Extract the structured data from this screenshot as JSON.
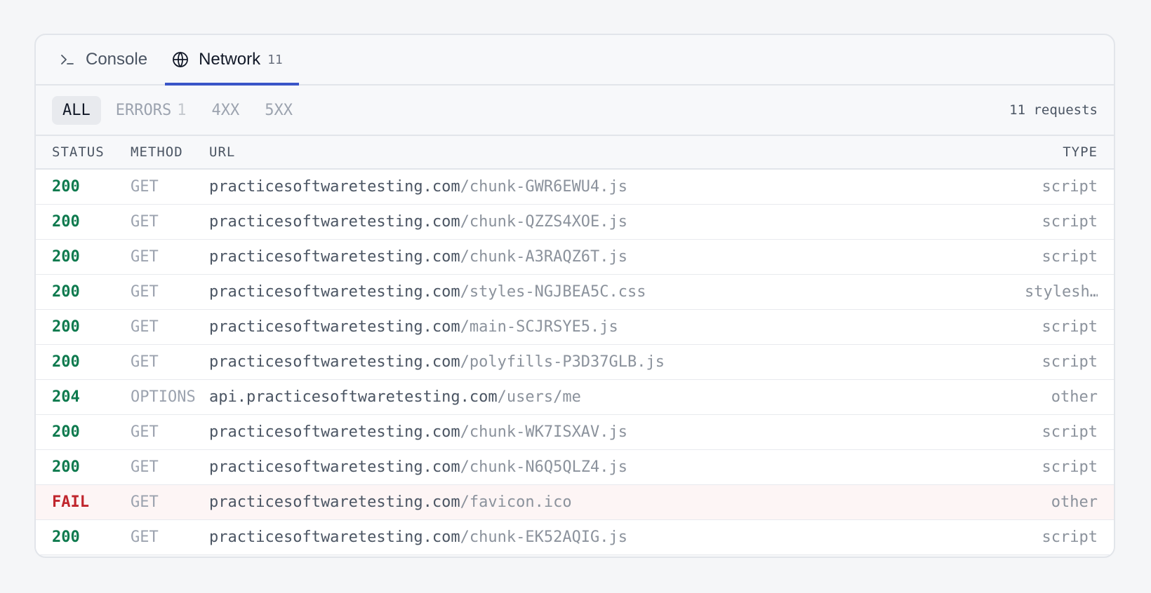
{
  "tabs": [
    {
      "label": "Console",
      "icon": "terminal-icon"
    },
    {
      "label": "Network",
      "icon": "globe-icon",
      "count": "11"
    }
  ],
  "filters": [
    {
      "label": "ALL"
    },
    {
      "label": "ERRORS",
      "badge": "1"
    },
    {
      "label": "4XX"
    },
    {
      "label": "5XX"
    }
  ],
  "request_count": "11 requests",
  "columns": {
    "status": "STATUS",
    "method": "METHOD",
    "url": "URL",
    "type": "TYPE"
  },
  "requests": [
    {
      "status": "200",
      "method": "GET",
      "host": "practicesoftwaretesting.com",
      "path": "/chunk-GWR6EWU4.js",
      "type": "script"
    },
    {
      "status": "200",
      "method": "GET",
      "host": "practicesoftwaretesting.com",
      "path": "/chunk-QZZS4XOE.js",
      "type": "script"
    },
    {
      "status": "200",
      "method": "GET",
      "host": "practicesoftwaretesting.com",
      "path": "/chunk-A3RAQZ6T.js",
      "type": "script"
    },
    {
      "status": "200",
      "method": "GET",
      "host": "practicesoftwaretesting.com",
      "path": "/styles-NGJBEA5C.css",
      "type": "stylesh…"
    },
    {
      "status": "200",
      "method": "GET",
      "host": "practicesoftwaretesting.com",
      "path": "/main-SCJRSYE5.js",
      "type": "script"
    },
    {
      "status": "200",
      "method": "GET",
      "host": "practicesoftwaretesting.com",
      "path": "/polyfills-P3D37GLB.js",
      "type": "script"
    },
    {
      "status": "204",
      "method": "OPTIONS",
      "host": "api.practicesoftwaretesting.com",
      "path": "/users/me",
      "type": "other"
    },
    {
      "status": "200",
      "method": "GET",
      "host": "practicesoftwaretesting.com",
      "path": "/chunk-WK7ISXAV.js",
      "type": "script"
    },
    {
      "status": "200",
      "method": "GET",
      "host": "practicesoftwaretesting.com",
      "path": "/chunk-N6Q5QLZ4.js",
      "type": "script"
    },
    {
      "status": "FAIL",
      "method": "GET",
      "host": "practicesoftwaretesting.com",
      "path": "/favicon.ico",
      "type": "other"
    },
    {
      "status": "200",
      "method": "GET",
      "host": "practicesoftwaretesting.com",
      "path": "/chunk-EK52AQIG.js",
      "type": "script"
    }
  ],
  "colors": {
    "accent": "#3a55c8",
    "status_ok": "#0e7a4e",
    "status_fail": "#c0262d"
  }
}
